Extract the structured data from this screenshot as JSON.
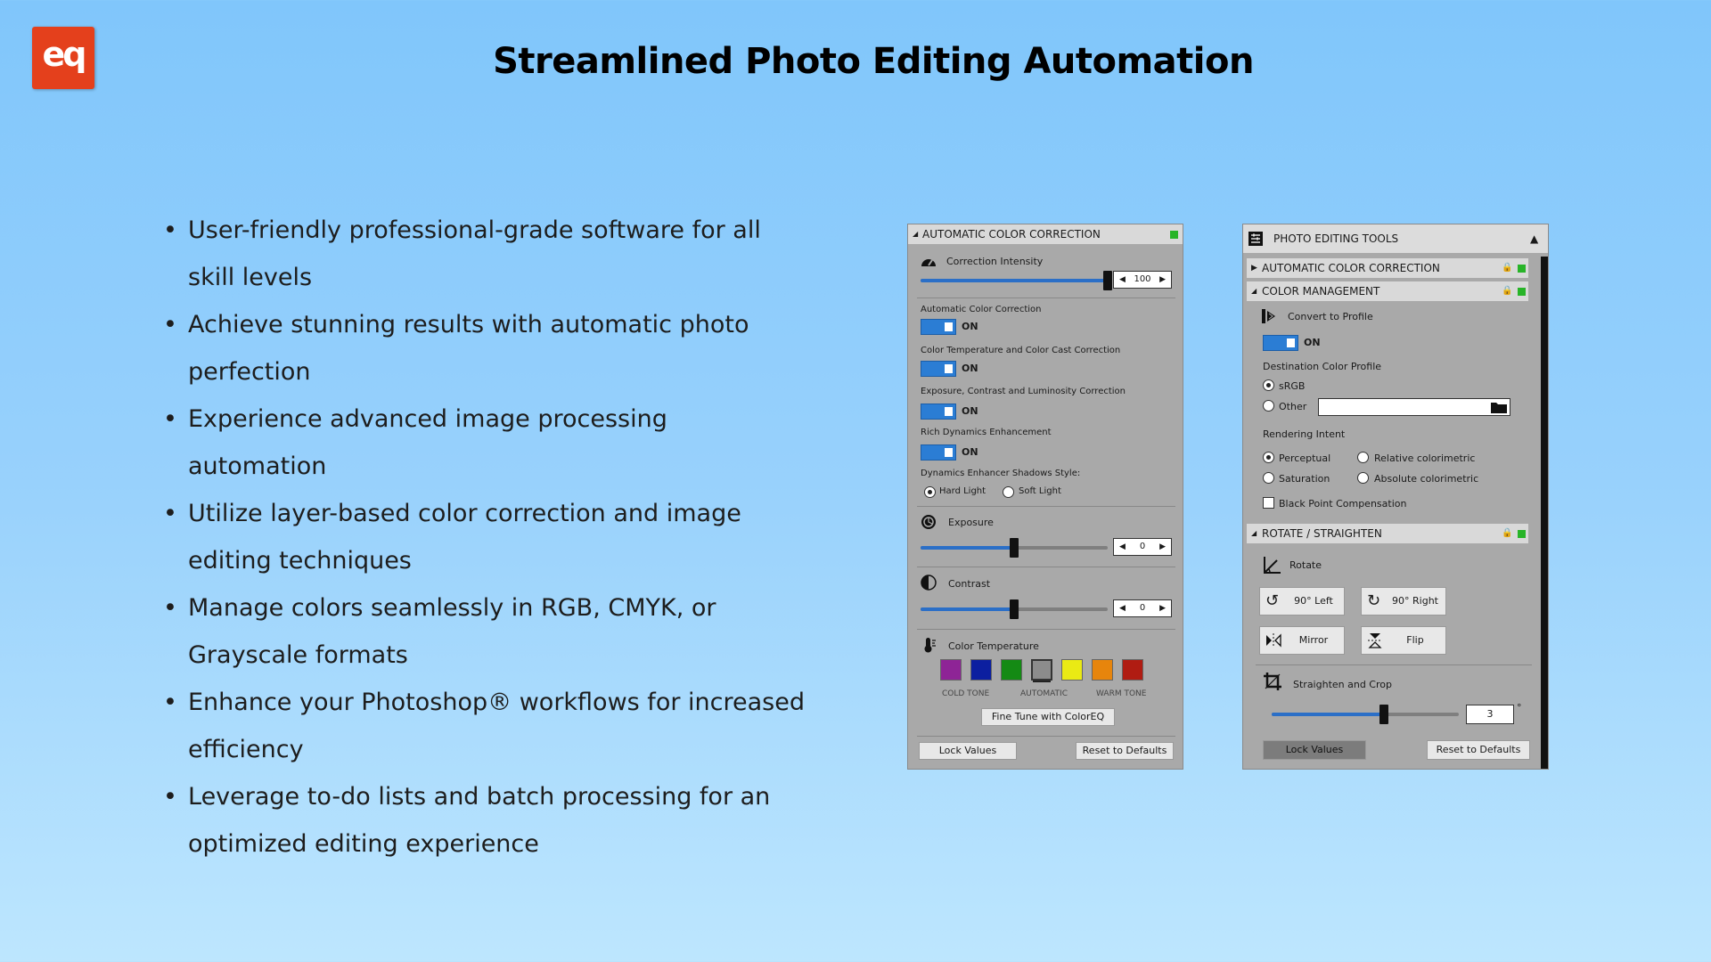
{
  "logo": {
    "text": "eq"
  },
  "title": "Streamlined Photo Editing Automation",
  "bullets": [
    "User-friendly professional-grade software for all skill levels",
    "Achieve stunning results with automatic photo perfection",
    "Experience advanced image processing automation",
    "Utilize layer-based color correction and image editing techniques",
    "Manage colors seamlessly in RGB, CMYK, or Grayscale formats",
    "Enhance your Photoshop® workflows for increased efficiency",
    "Leverage to-do lists and batch processing for an optimized editing experience"
  ],
  "panel1": {
    "header": "AUTOMATIC COLOR CORRECTION",
    "correction_intensity": {
      "label": "Correction Intensity",
      "value": "100",
      "level": 1.0
    },
    "toggles": [
      {
        "label": "Automatic Color Correction",
        "state": "ON"
      },
      {
        "label": "Color Temperature and Color Cast Correction",
        "state": "ON"
      },
      {
        "label": "Exposure, Contrast and Luminosity Correction",
        "state": "ON"
      },
      {
        "label": "Rich Dynamics Enhancement",
        "state": "ON"
      }
    ],
    "shadows_style": {
      "label": "Dynamics Enhancer Shadows Style:",
      "options": [
        "Hard Light",
        "Soft Light"
      ],
      "selected": "Hard Light"
    },
    "exposure": {
      "label": "Exposure",
      "value": "0",
      "level": 0.5
    },
    "contrast": {
      "label": "Contrast",
      "value": "0",
      "level": 0.5
    },
    "color_temperature": {
      "label": "Color Temperature",
      "swatches": [
        "#8e2496",
        "#0c1fa0",
        "#148a14",
        "#8c8c8c",
        "#eaea14",
        "#e7850c",
        "#b01c12"
      ],
      "selected_index": 3,
      "captions": [
        "COLD TONE",
        "AUTOMATIC",
        "WARM TONE"
      ],
      "fine_tune": "Fine Tune with ColorEQ"
    },
    "lock_values": "Lock Values",
    "reset": "Reset to Defaults",
    "accent": "#2b6fc7"
  },
  "panel2": {
    "header": "PHOTO EDITING TOOLS",
    "sections": {
      "auto": "AUTOMATIC COLOR CORRECTION",
      "color_mgmt": "COLOR MANAGEMENT",
      "rotate": "ROTATE / STRAIGHTEN"
    },
    "convert_label": "Convert to Profile",
    "convert_state": "ON",
    "dest_label": "Destination Color Profile",
    "dest_options": [
      "sRGB",
      "Other"
    ],
    "dest_selected": "sRGB",
    "other_value": "",
    "intent_label": "Rendering Intent",
    "intent_options": [
      "Perceptual",
      "Relative colorimetric",
      "Saturation",
      "Absolute colorimetric"
    ],
    "intent_selected": "Perceptual",
    "black_point": "Black Point Compensation",
    "rotate_label": "Rotate",
    "btn_left": "90° Left",
    "btn_right": "90° Right",
    "btn_mirror": "Mirror",
    "btn_flip": "Flip",
    "straighten_label": "Straighten and Crop",
    "straighten_value": "3",
    "degree": "°",
    "straighten_level": 0.6,
    "lock_values": "Lock Values",
    "reset": "Reset to Defaults"
  }
}
